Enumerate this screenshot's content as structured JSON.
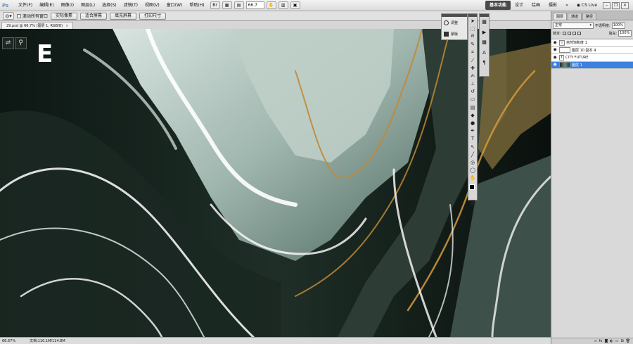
{
  "app": {
    "logo": "Ps"
  },
  "menu": {
    "items": [
      "文件(F)",
      "编辑(E)",
      "图像(I)",
      "图层(L)",
      "选择(S)",
      "滤镜(T)",
      "视图(V)",
      "窗口(W)",
      "帮助(H)"
    ]
  },
  "topbar": {
    "zoom": "66.7",
    "workspaces": [
      "基本功能",
      "设计",
      "绘画",
      "摄影"
    ],
    "cs_live": "CS Live"
  },
  "options": {
    "scroll_all": "滚动所有窗口",
    "buttons": [
      "实际像素",
      "适合屏幕",
      "填充屏幕",
      "打印尺寸"
    ]
  },
  "document": {
    "tab": "29.psd @ 66.7% (图层 1, RGB/8)",
    "letter": "E"
  },
  "status": {
    "zoom": "66.67%",
    "doc_info": "文档:110.1M/114.8M"
  },
  "adjust_panel": {
    "items": [
      "调整",
      "蒙版"
    ]
  },
  "layers_panel": {
    "tabs": [
      "图层",
      "通道",
      "路径"
    ],
    "blend_mode": "正常",
    "opacity_label": "不透明度:",
    "opacity": "100%",
    "lock_label": "锁定:",
    "fill_label": "填充:",
    "fill": "100%",
    "layers": [
      {
        "name": "自然饱和度 1",
        "type": "adjustment"
      },
      {
        "name": "图层 10 副本 4",
        "type": "normal"
      },
      {
        "name": "CITY FUTURE",
        "type": "text"
      },
      {
        "name": "图层 1",
        "type": "image"
      }
    ]
  }
}
